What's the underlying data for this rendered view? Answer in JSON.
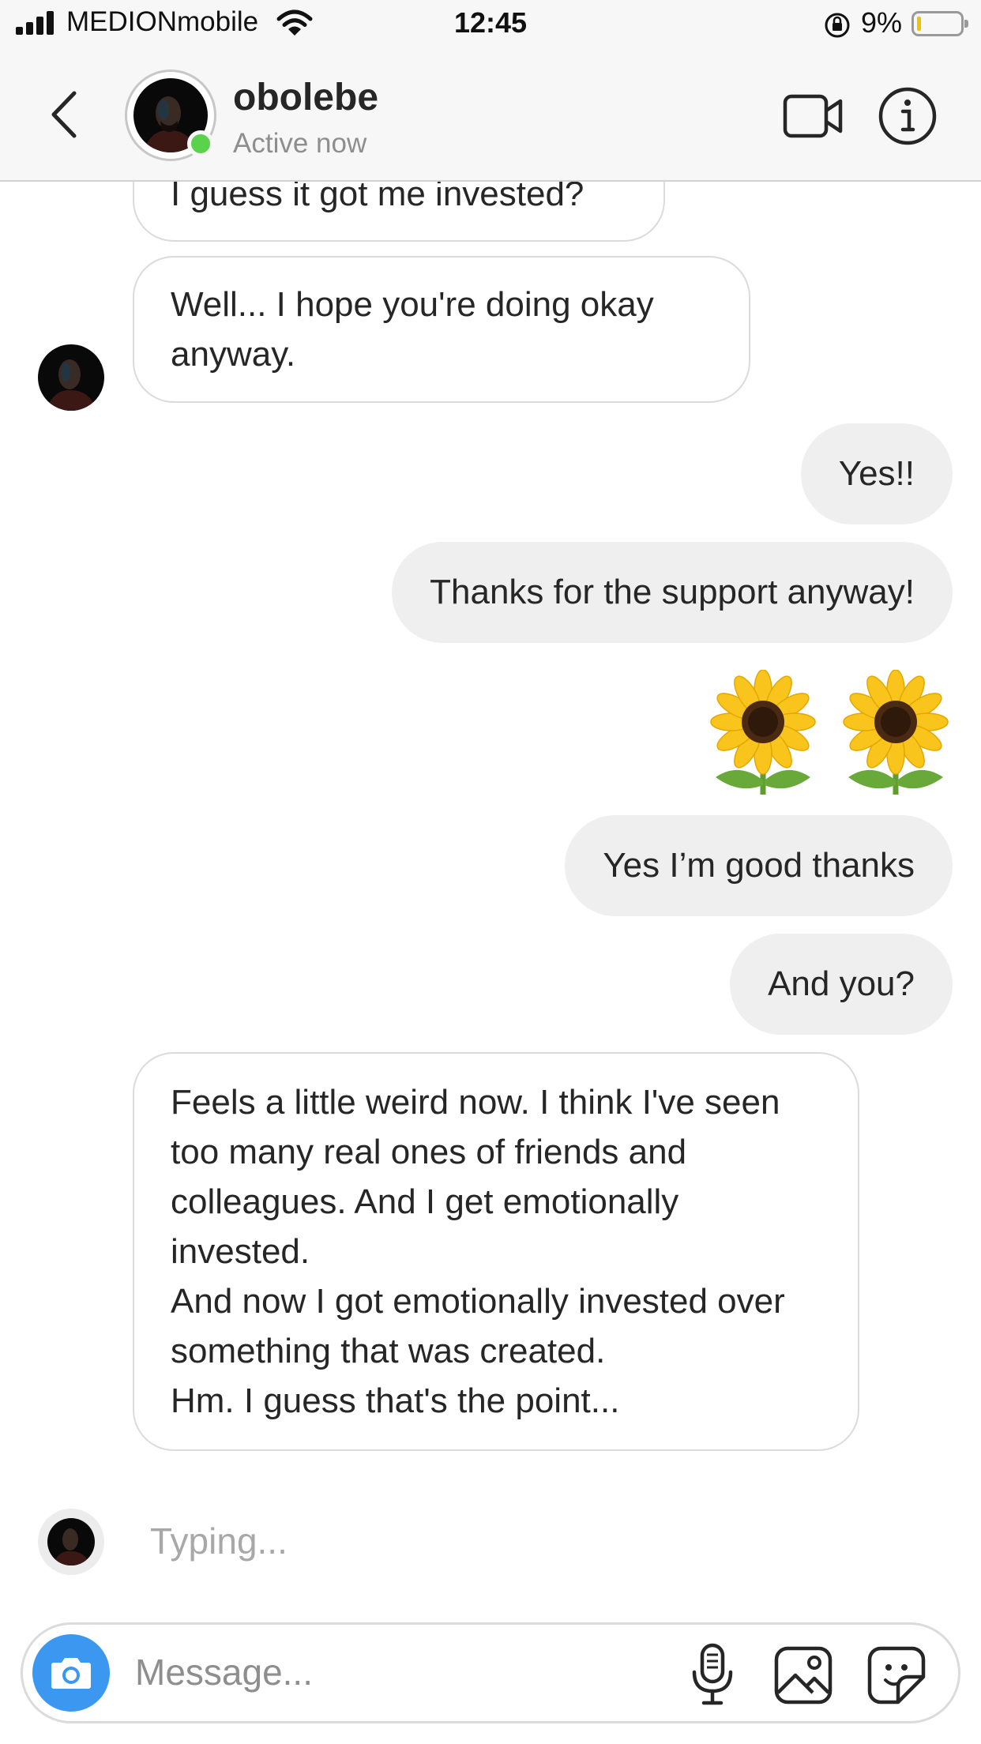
{
  "status_bar": {
    "carrier": "MEDIONmobile",
    "time": "12:45",
    "battery_percent": "9%",
    "battery_level": 0.09
  },
  "header": {
    "username": "obolebe",
    "activity": "Active now"
  },
  "messages": [
    {
      "from": "them",
      "text": "I guess it got me invested?"
    },
    {
      "from": "them",
      "text": "Well... I hope you're doing okay anyway."
    },
    {
      "from": "me",
      "text": "Yes!!"
    },
    {
      "from": "me",
      "text": "Thanks for the support anyway!"
    },
    {
      "from": "me",
      "text": "🌻🌻",
      "emoji": "sunflower"
    },
    {
      "from": "me",
      "text": "Yes I’m good thanks"
    },
    {
      "from": "me",
      "text": "And you?"
    },
    {
      "from": "them",
      "text": "Feels a little weird now. I think I've seen too many real ones of friends and colleagues. And I get emotionally invested.\nAnd now I got emotionally invested over something that was created.\nHm. I guess that's the point..."
    }
  ],
  "typing_indicator": "Typing...",
  "composer": {
    "placeholder": "Message...",
    "icons": [
      "camera-icon",
      "microphone-icon",
      "gallery-icon",
      "sticker-icon"
    ]
  },
  "colors": {
    "online": "#5bd24c",
    "camera_button": "#3b97f0",
    "outgoing_bubble": "#efefef",
    "incoming_border": "#dbdbdb"
  }
}
